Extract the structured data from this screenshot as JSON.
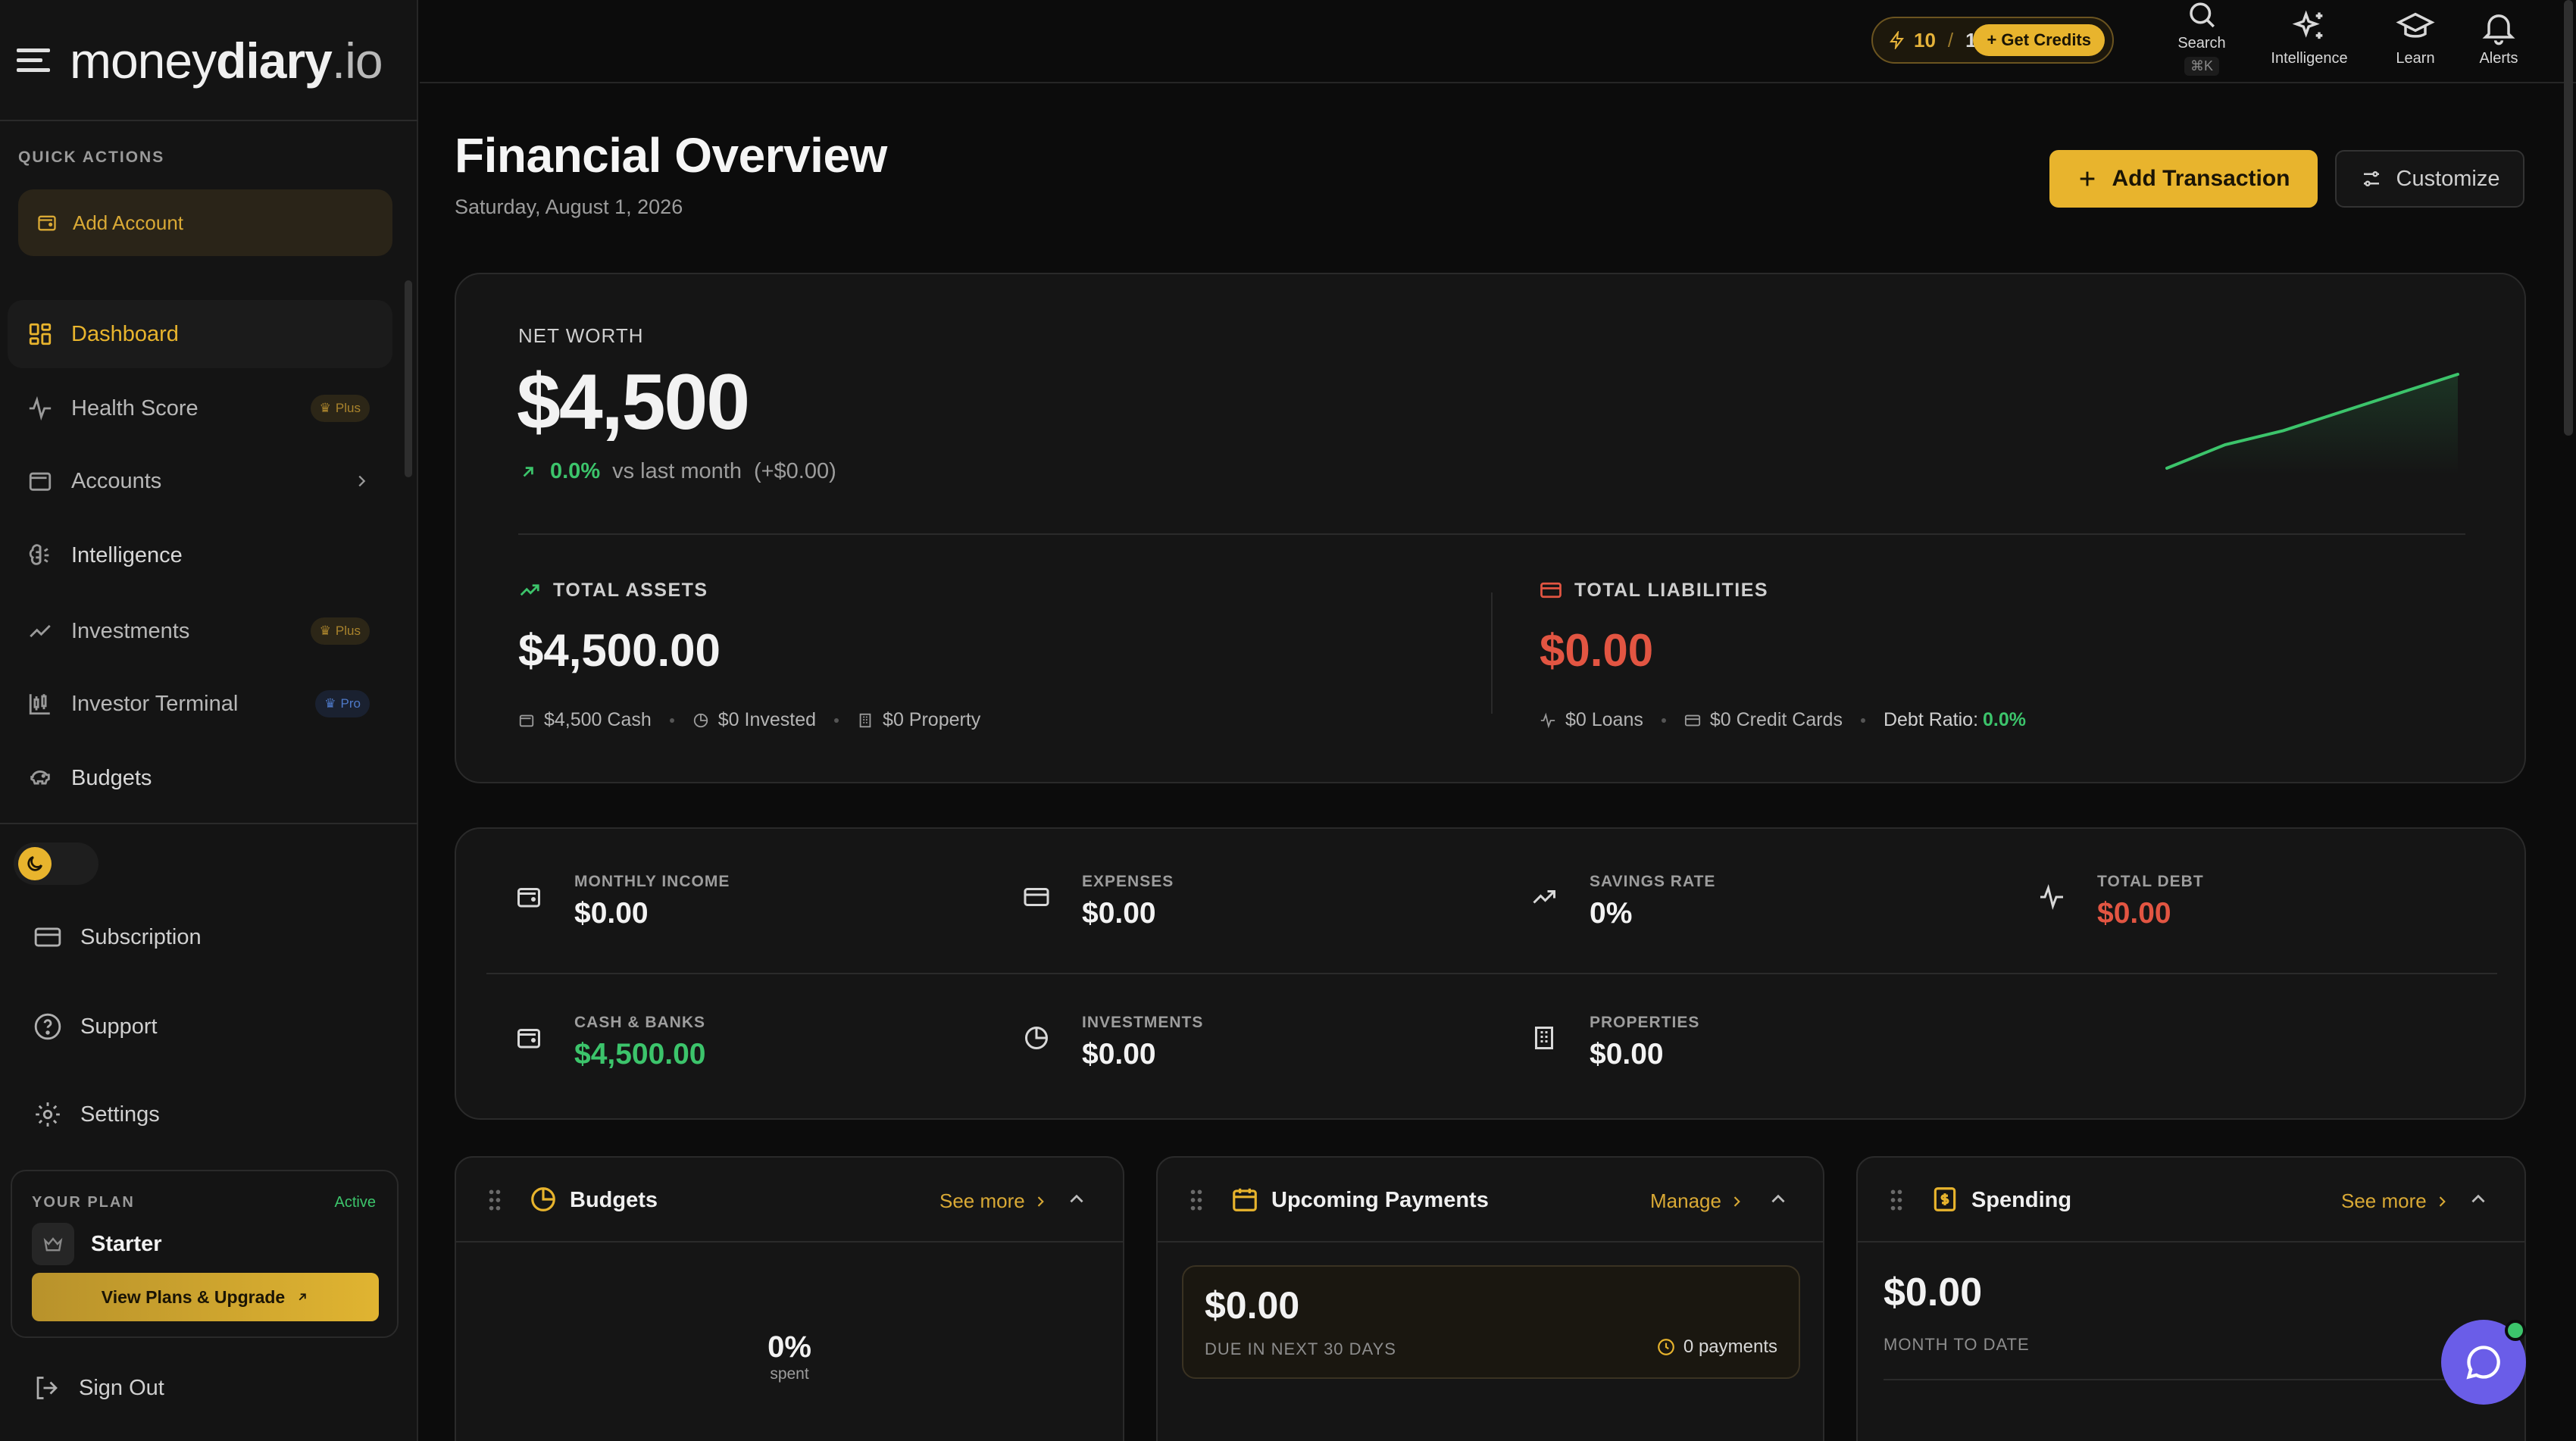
{
  "app": {
    "logo_money": "money",
    "logo_diary": "diary",
    "logo_tld": ".io"
  },
  "sidebar": {
    "quick_actions_label": "QUICK ACTIONS",
    "add_account_label": "Add Account",
    "items": [
      {
        "label": "Dashboard",
        "icon": "grid-icon",
        "active": true
      },
      {
        "label": "Health Score",
        "icon": "pulse-icon",
        "badge": "Plus"
      },
      {
        "label": "Accounts",
        "icon": "wallet-icon"
      },
      {
        "label": "Intelligence",
        "icon": "brain-icon"
      },
      {
        "label": "Investments",
        "icon": "trend-up-icon",
        "badge": "Plus"
      },
      {
        "label": "Investor Terminal",
        "icon": "candlestick-icon",
        "badge": "Pro"
      },
      {
        "label": "Budgets",
        "icon": "piggy-bank-icon"
      }
    ],
    "subscription_label": "Subscription",
    "support_label": "Support",
    "settings_label": "Settings",
    "plan": {
      "your_plan_label": "YOUR PLAN",
      "status": "Active",
      "tier": "Starter",
      "upgrade_label": "View Plans & Upgrade"
    },
    "sign_out_label": "Sign Out"
  },
  "topbar": {
    "credits_used": "10",
    "credits_sep": "/",
    "credits_total": "10",
    "get_credits_label": "+ Get Credits",
    "search_label": "Search",
    "search_shortcut": "⌘K",
    "intelligence_label": "Intelligence",
    "learn_label": "Learn",
    "alerts_label": "Alerts"
  },
  "header": {
    "title": "Financial Overview",
    "date": "Saturday, August 1, 2026",
    "add_transaction_label": "Add Transaction",
    "customize_label": "Customize"
  },
  "net_worth": {
    "label": "NET WORTH",
    "value": "$4,500",
    "change_pct": "0.0%",
    "vs_label": "vs last month",
    "change_abs": "(+$0.00)",
    "sparkline": [
      4480,
      4485,
      4488,
      4492,
      4496,
      4500
    ]
  },
  "assets": {
    "label": "TOTAL ASSETS",
    "value": "$4,500.00",
    "cash": "$4,500 Cash",
    "invested": "$0 Invested",
    "property": "$0 Property"
  },
  "liabilities": {
    "label": "TOTAL LIABILITIES",
    "value": "$0.00",
    "loans": "$0 Loans",
    "credit_cards": "$0 Credit Cards",
    "debt_ratio_label": "Debt Ratio:",
    "debt_ratio_value": "0.0%"
  },
  "metrics": [
    {
      "label": "MONTHLY INCOME",
      "value": "$0.00",
      "icon": "wallet-icon",
      "color": "#f2f2f2"
    },
    {
      "label": "EXPENSES",
      "value": "$0.00",
      "icon": "credit-card-icon",
      "color": "#f2f2f2"
    },
    {
      "label": "SAVINGS RATE",
      "value": "0%",
      "icon": "trend-up-icon",
      "color": "#f2f2f2"
    },
    {
      "label": "TOTAL DEBT",
      "value": "$0.00",
      "icon": "pulse-icon",
      "color": "#e25542"
    },
    {
      "label": "CASH & BANKS",
      "value": "$4,500.00",
      "icon": "wallet-icon",
      "color": "#3cc46b"
    },
    {
      "label": "INVESTMENTS",
      "value": "$0.00",
      "icon": "pie-chart-icon",
      "color": "#f2f2f2"
    },
    {
      "label": "PROPERTIES",
      "value": "$0.00",
      "icon": "building-icon",
      "color": "#f2f2f2"
    }
  ],
  "widgets": {
    "budgets": {
      "title": "Budgets",
      "link": "See more",
      "pct": "0%",
      "pct_caption": "spent"
    },
    "upcoming": {
      "title": "Upcoming Payments",
      "link": "Manage",
      "amount": "$0.00",
      "caption": "DUE IN NEXT 30 DAYS",
      "count": "0 payments"
    },
    "spending": {
      "title": "Spending",
      "link": "See more",
      "amount": "$0.00",
      "caption": "MONTH TO DATE"
    }
  },
  "colors": {
    "accent": "#e8b42d",
    "positive": "#3cc46b",
    "negative": "#e25542",
    "chat": "#6a5de8"
  }
}
